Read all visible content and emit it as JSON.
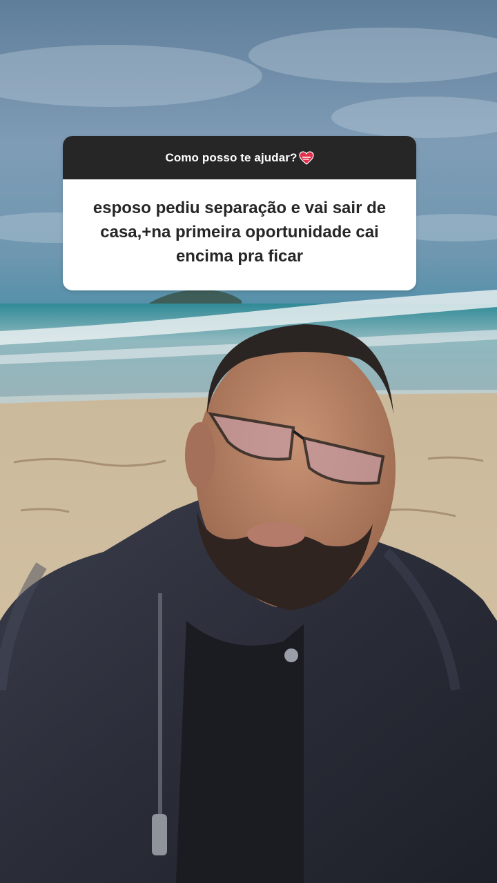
{
  "question_sticker": {
    "prompt": "Como posso te ajudar?",
    "prompt_icon": "mending-heart-icon",
    "answer": "esposo pediu separação e vai sair de casa,+na primeira oportunidade cai encima pra ficar"
  },
  "colors": {
    "header_bg": "#262626",
    "card_bg": "#ffffff",
    "answer_text": "#262626",
    "heart": "#e0314b"
  }
}
